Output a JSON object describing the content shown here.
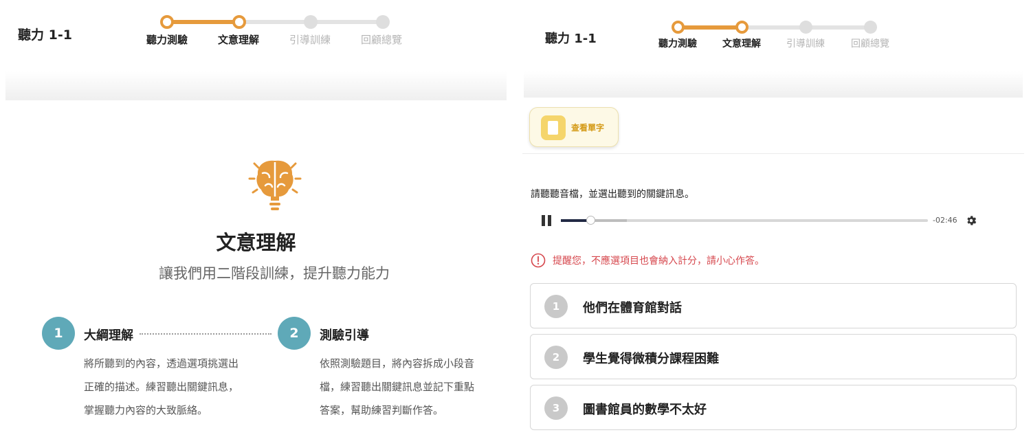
{
  "left": {
    "header": {
      "title": "聽力 1-1",
      "steps": [
        {
          "label": "聽力測驗",
          "status": "done"
        },
        {
          "label": "文意理解",
          "status": "done"
        },
        {
          "label": "引導訓練",
          "status": "todo"
        },
        {
          "label": "回顧總覽",
          "status": "todo"
        }
      ]
    },
    "intro": {
      "icon": "brain-lightbulb-icon",
      "title": "文意理解",
      "subtitle": "讓我們用二階段訓練，提升聽力能力"
    },
    "stages": [
      {
        "number": "1",
        "title": "大綱理解",
        "description_lines": [
          "將所聽到的內容，透過選項挑選出",
          "正確的描述。練習聽出關鍵訊息，",
          "掌握聽力內容的大致脈絡。"
        ]
      },
      {
        "number": "2",
        "title": "測驗引導",
        "description_lines": [
          "依照測驗題目，將內容拆成小段音",
          "檔，練習聽出關鍵訊息並記下重點",
          "答案，幫助練習判斷作答。"
        ]
      }
    ]
  },
  "right": {
    "header": {
      "title": "聽力 1-1",
      "steps": [
        {
          "label": "聽力測驗",
          "status": "done"
        },
        {
          "label": "文意理解",
          "status": "done"
        },
        {
          "label": "引導訓練",
          "status": "todo"
        },
        {
          "label": "回顧總覽",
          "status": "todo"
        }
      ]
    },
    "vocab_button": {
      "label": "查看單字",
      "icon": "notebook-icon"
    },
    "instruction": "請聽聽音檔，並選出聽到的關鍵訊息。",
    "audio": {
      "time_remaining": "-02:46",
      "progress": 0.08,
      "buffered": 0.18,
      "state": "playing"
    },
    "warning": {
      "icon": "alert-circle-icon",
      "text": "提醒您，不應選項目也會納入計分，請小心作答。"
    },
    "options": [
      {
        "number": "1",
        "text": "他們在體育館對話"
      },
      {
        "number": "2",
        "text": "學生覺得微積分課程困難"
      },
      {
        "number": "3",
        "text": "圖書館員的數學不太好"
      }
    ]
  },
  "colors": {
    "accent": "#e69a3c",
    "step_inactive": "#dedede",
    "stage_circle": "#5fa9b8",
    "warning": "#d6474d",
    "vocab_bg": "#fdf9e6"
  }
}
